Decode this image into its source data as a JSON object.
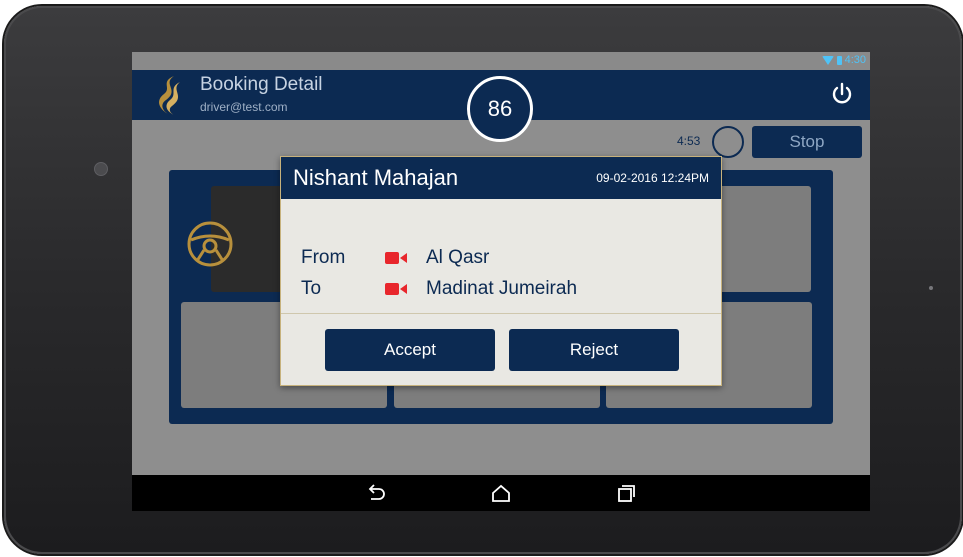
{
  "status": {
    "time": "4:30"
  },
  "app": {
    "title": "Booking Detail",
    "subtitle": "driver@test.com",
    "timer_value": "86"
  },
  "trip": {
    "countdown": "4:53",
    "stop_label": "Stop"
  },
  "dialog": {
    "name": "Nishant Mahajan",
    "datetime": "09-02-2016 12:24PM",
    "from_label": "From",
    "from_place": "Al Qasr",
    "to_label": "To",
    "to_place": "Madinat Jumeirah",
    "accept_label": "Accept",
    "reject_label": "Reject"
  },
  "icons": [
    "wifi-icon",
    "battery-icon",
    "logo-icon",
    "power-icon",
    "steering-wheel-icon",
    "video-camera-icon",
    "back-icon",
    "home-icon",
    "recents-icon"
  ],
  "colors": {
    "primary": "#0c2a52",
    "accent": "#e8262c",
    "status": "#4fc3f7"
  }
}
